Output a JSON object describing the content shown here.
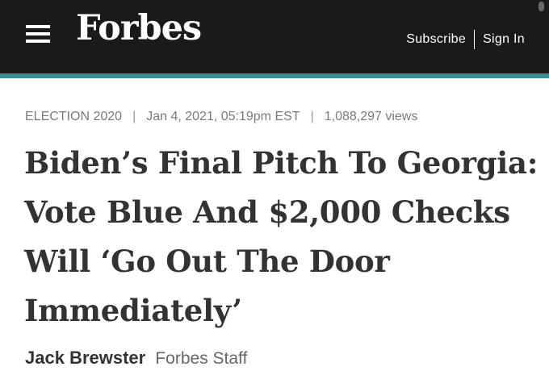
{
  "header": {
    "logo": "Forbes",
    "subscribe_label": "Subscribe",
    "signin_label": "Sign In",
    "background_color": "#1a1a1a",
    "accent_color": "#3c8c97",
    "menu_icon": "hamburger-menu-icon"
  },
  "article": {
    "category": "ELECTION 2020",
    "date": "Jan 4, 2021, 05:19pm EST",
    "views": "1,088,297 views",
    "separator": "|",
    "headline": "Biden’s Final Pitch To Georgia: Vote Blue And $2,000 Checks Will ‘Go Out The Door Immediately’",
    "author": "Jack Brewster",
    "author_role": "Forbes Staff"
  }
}
